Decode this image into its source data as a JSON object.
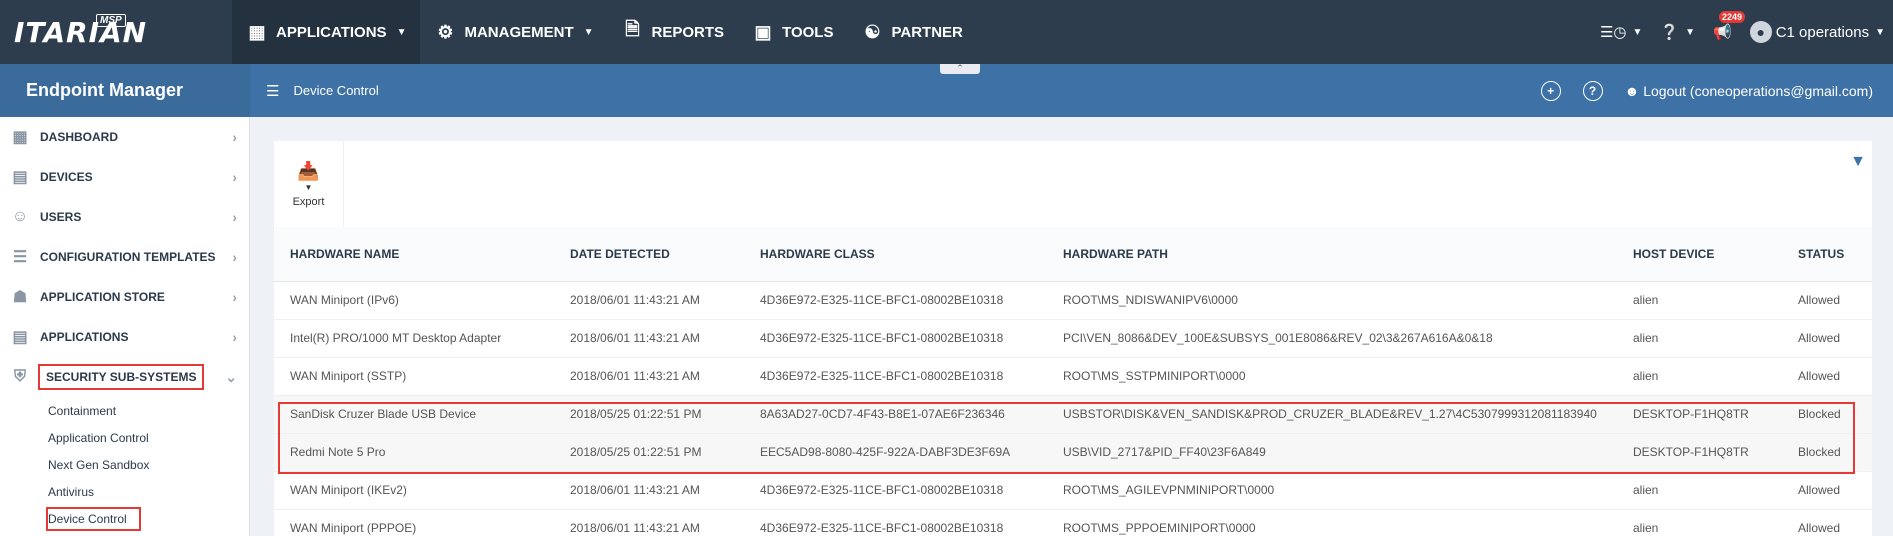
{
  "logo": {
    "text": "ITARIAN",
    "badge": "MSP"
  },
  "nav": [
    {
      "label": "APPLICATIONS",
      "icon": "grid-icon",
      "caret": true,
      "active": true
    },
    {
      "label": "MANAGEMENT",
      "icon": "gear-icon",
      "caret": true
    },
    {
      "label": "REPORTS",
      "icon": "document-icon"
    },
    {
      "label": "TOOLS",
      "icon": "toolbox-icon"
    },
    {
      "label": "PARTNER",
      "icon": "handshake-icon"
    }
  ],
  "top_right": {
    "notifications_count": "2249",
    "user": "C1 operations"
  },
  "app_title": "Endpoint Manager",
  "page_title": "Device Control",
  "logout_label": "Logout (coneoperations@gmail.com)",
  "sidebar": {
    "items": [
      {
        "label": "DASHBOARD",
        "icon": "dashboard-icon"
      },
      {
        "label": "DEVICES",
        "icon": "devices-icon"
      },
      {
        "label": "USERS",
        "icon": "user-icon"
      },
      {
        "label": "CONFIGURATION TEMPLATES",
        "icon": "templates-icon"
      },
      {
        "label": "APPLICATION STORE",
        "icon": "store-icon"
      },
      {
        "label": "APPLICATIONS",
        "icon": "applications-icon"
      },
      {
        "label": "SECURITY SUB-SYSTEMS",
        "icon": "shield-icon",
        "expanded": true
      }
    ],
    "sub_items": [
      "Containment",
      "Application Control",
      "Next Gen Sandbox",
      "Antivirus",
      "Device Control"
    ]
  },
  "toolbar": {
    "export_label": "Export"
  },
  "table": {
    "columns": [
      "HARDWARE NAME",
      "DATE DETECTED",
      "HARDWARE CLASS",
      "HARDWARE PATH",
      "HOST DEVICE",
      "STATUS"
    ],
    "rows": [
      [
        "WAN Miniport (IPv6)",
        "2018/06/01 11:43:21 AM",
        "4D36E972-E325-11CE-BFC1-08002BE10318",
        "ROOT\\MS_NDISWANIPV6\\0000",
        "alien",
        "Allowed"
      ],
      [
        "Intel(R) PRO/1000 MT Desktop Adapter",
        "2018/06/01 11:43:21 AM",
        "4D36E972-E325-11CE-BFC1-08002BE10318",
        "PCI\\VEN_8086&DEV_100E&SUBSYS_001E8086&REV_02\\3&267A616A&0&18",
        "alien",
        "Allowed"
      ],
      [
        "WAN Miniport (SSTP)",
        "2018/06/01 11:43:21 AM",
        "4D36E972-E325-11CE-BFC1-08002BE10318",
        "ROOT\\MS_SSTPMINIPORT\\0000",
        "alien",
        "Allowed"
      ],
      [
        "SanDisk Cruzer Blade USB Device",
        "2018/05/25 01:22:51 PM",
        "8A63AD27-0CD7-4F43-B8E1-07AE6F236346",
        "USBSTOR\\DISK&VEN_SANDISK&PROD_CRUZER_BLADE&REV_1.27\\4C5307999312081183940",
        "DESKTOP-F1HQ8TR",
        "Blocked"
      ],
      [
        "Redmi Note 5 Pro",
        "2018/05/25 01:22:51 PM",
        "EEC5AD98-8080-425F-922A-DABF3DE3F69A",
        "USB\\VID_2717&PID_FF40\\23F6A849",
        "DESKTOP-F1HQ8TR",
        "Blocked"
      ],
      [
        "WAN Miniport (IKEv2)",
        "2018/06/01 11:43:21 AM",
        "4D36E972-E325-11CE-BFC1-08002BE10318",
        "ROOT\\MS_AGILEVPNMINIPORT\\0000",
        "alien",
        "Allowed"
      ],
      [
        "WAN Miniport (PPPOE)",
        "2018/06/01 11:43:21 AM",
        "4D36E972-E325-11CE-BFC1-08002BE10318",
        "ROOT\\MS_PPPOEMINIPORT\\0000",
        "alien",
        "Allowed"
      ]
    ]
  },
  "colors": {
    "topbar": "#2e3d4e",
    "subbar": "#3e72a6",
    "highlight": "#e53935"
  }
}
